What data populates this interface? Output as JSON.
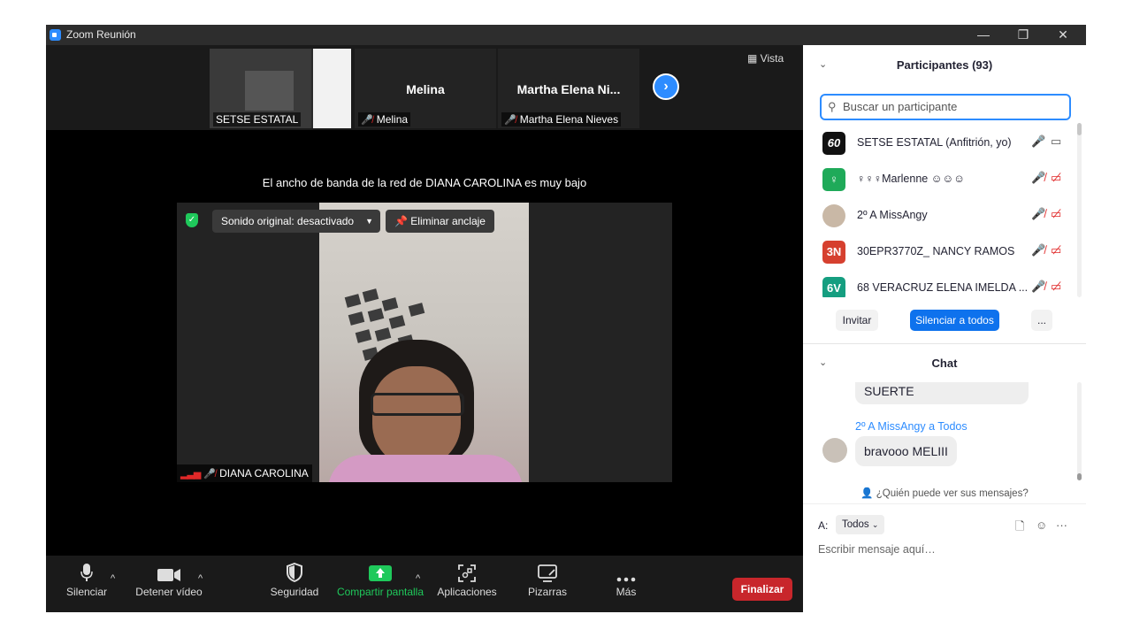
{
  "window": {
    "title": "Zoom Reunión",
    "minimize": "—",
    "restore": "❐",
    "close": "✕"
  },
  "strip": {
    "thumb1_name": "SETSE ESTATAL",
    "thumb2_big": "Melina",
    "thumb2_name": "Melina",
    "thumb3_big": "Martha Elena Ni...",
    "thumb3_name": "Martha Elena Nieves",
    "next_icon": "›",
    "vista_label": "Vista"
  },
  "main_video": {
    "bandwidth_message": "El ancho de banda de la red de DIANA CAROLINA es muy bajo",
    "audio_status": "Sonido original: desactivado",
    "unpin_label": "Eliminar anclaje",
    "name": "DIANA CAROLINA"
  },
  "toolbar": {
    "mute": "Silenciar",
    "video": "Detener vídeo",
    "security": "Seguridad",
    "share": "Compartir pantalla",
    "apps": "Aplicaciones",
    "whiteboards": "Pizarras",
    "more": "Más",
    "end": "Finalizar"
  },
  "participants": {
    "header": "Participantes (93)",
    "search_placeholder": "Buscar un participante",
    "list": [
      {
        "avatar": "60",
        "name": "SETSE ESTATAL (Anfitrión, yo)",
        "avatar_color": "#111111"
      },
      {
        "avatar": "♀",
        "name": "♀♀♀Marlenne ☺☺☺",
        "avatar_color": "#1faa59"
      },
      {
        "avatar": "",
        "name": "2º A  MissAngy",
        "avatar_color": "#c9b8a6"
      },
      {
        "avatar": "3N",
        "name": "30EPR3770Z_ NANCY RAMOS",
        "avatar_color": "#d6402f"
      },
      {
        "avatar": "6V",
        "name": "68 VERACRUZ ELENA IMELDA ...",
        "avatar_color": "#159e80"
      }
    ],
    "invite": "Invitar",
    "mute_all": "Silenciar a todos",
    "more": "..."
  },
  "chat": {
    "header": "Chat",
    "msg1": "SUERTE",
    "sender2": "2º A  MissAngy a Todos",
    "msg2": "bravooo MELIII",
    "who_can_see": "¿Quién puede ver sus mensajes?",
    "to_label": "A:",
    "to_value": "Todos",
    "input_placeholder": "Escribir mensaje aquí…"
  }
}
